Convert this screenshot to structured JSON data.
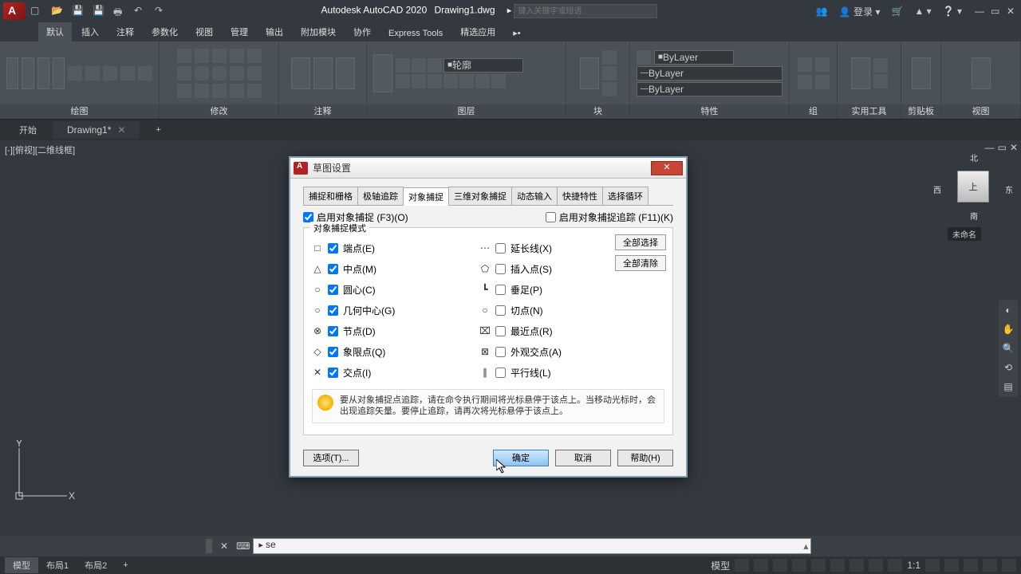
{
  "title": {
    "app": "Autodesk AutoCAD 2020",
    "doc": "Drawing1.dwg",
    "search_placeholder": "键入关键字或短语",
    "login": "登录"
  },
  "menu": {
    "tabs": [
      "默认",
      "插入",
      "注释",
      "参数化",
      "视图",
      "管理",
      "输出",
      "附加模块",
      "协作",
      "Express Tools",
      "精选应用"
    ]
  },
  "ribbon": {
    "panels": [
      "绘图",
      "修改",
      "注释",
      "图层",
      "块",
      "特性",
      "组",
      "实用工具",
      "剪贴板",
      "视图"
    ],
    "layer_name": "轮廓",
    "bylayer": "ByLayer"
  },
  "doctabs": {
    "start": "开始",
    "doc": "Drawing1*"
  },
  "viewport": {
    "label": "[-][俯视][二维线框]"
  },
  "navcube": {
    "top": "上",
    "n": "北",
    "s": "南",
    "e": "东",
    "w": "西",
    "wcs": "未命名"
  },
  "dialog": {
    "title": "草图设置",
    "tabs": [
      "捕捉和栅格",
      "极轴追踪",
      "对象捕捉",
      "三维对象捕捉",
      "动态输入",
      "快捷特性",
      "选择循环"
    ],
    "enable_osnap": "启用对象捕捉 (F3)(O)",
    "enable_track": "启用对象捕捉追踪 (F11)(K)",
    "group_label": "对象捕捉模式",
    "snaps_left": [
      {
        "icon": "□",
        "label": "端点(E)",
        "checked": true
      },
      {
        "icon": "△",
        "label": "中点(M)",
        "checked": true
      },
      {
        "icon": "○",
        "label": "圆心(C)",
        "checked": true
      },
      {
        "icon": "○",
        "label": "几何中心(G)",
        "checked": true
      },
      {
        "icon": "⊗",
        "label": "节点(D)",
        "checked": true
      },
      {
        "icon": "◇",
        "label": "象限点(Q)",
        "checked": true
      },
      {
        "icon": "✕",
        "label": "交点(I)",
        "checked": true
      }
    ],
    "snaps_right": [
      {
        "icon": "⋯",
        "label": "延长线(X)",
        "checked": false
      },
      {
        "icon": "⬠",
        "label": "插入点(S)",
        "checked": false
      },
      {
        "icon": "┗",
        "label": "垂足(P)",
        "checked": false
      },
      {
        "icon": "○",
        "label": "切点(N)",
        "checked": false
      },
      {
        "icon": "⌧",
        "label": "最近点(R)",
        "checked": false
      },
      {
        "icon": "⊠",
        "label": "外观交点(A)",
        "checked": false
      },
      {
        "icon": "∥",
        "label": "平行线(L)",
        "checked": false
      }
    ],
    "select_all": "全部选择",
    "clear_all": "全部清除",
    "hint": "要从对象捕捉点追踪，请在命令执行期间将光标悬停于该点上。当移动光标时，会出现追踪矢量。要停止追踪，请再次将光标悬停于该点上。",
    "options_btn": "选项(T)...",
    "ok": "确定",
    "cancel": "取消",
    "help": "帮助(H)"
  },
  "cmd": {
    "text": "se"
  },
  "status": {
    "tabs": [
      "模型",
      "布局1",
      "布局2"
    ],
    "model": "模型",
    "scale": "1:1"
  }
}
